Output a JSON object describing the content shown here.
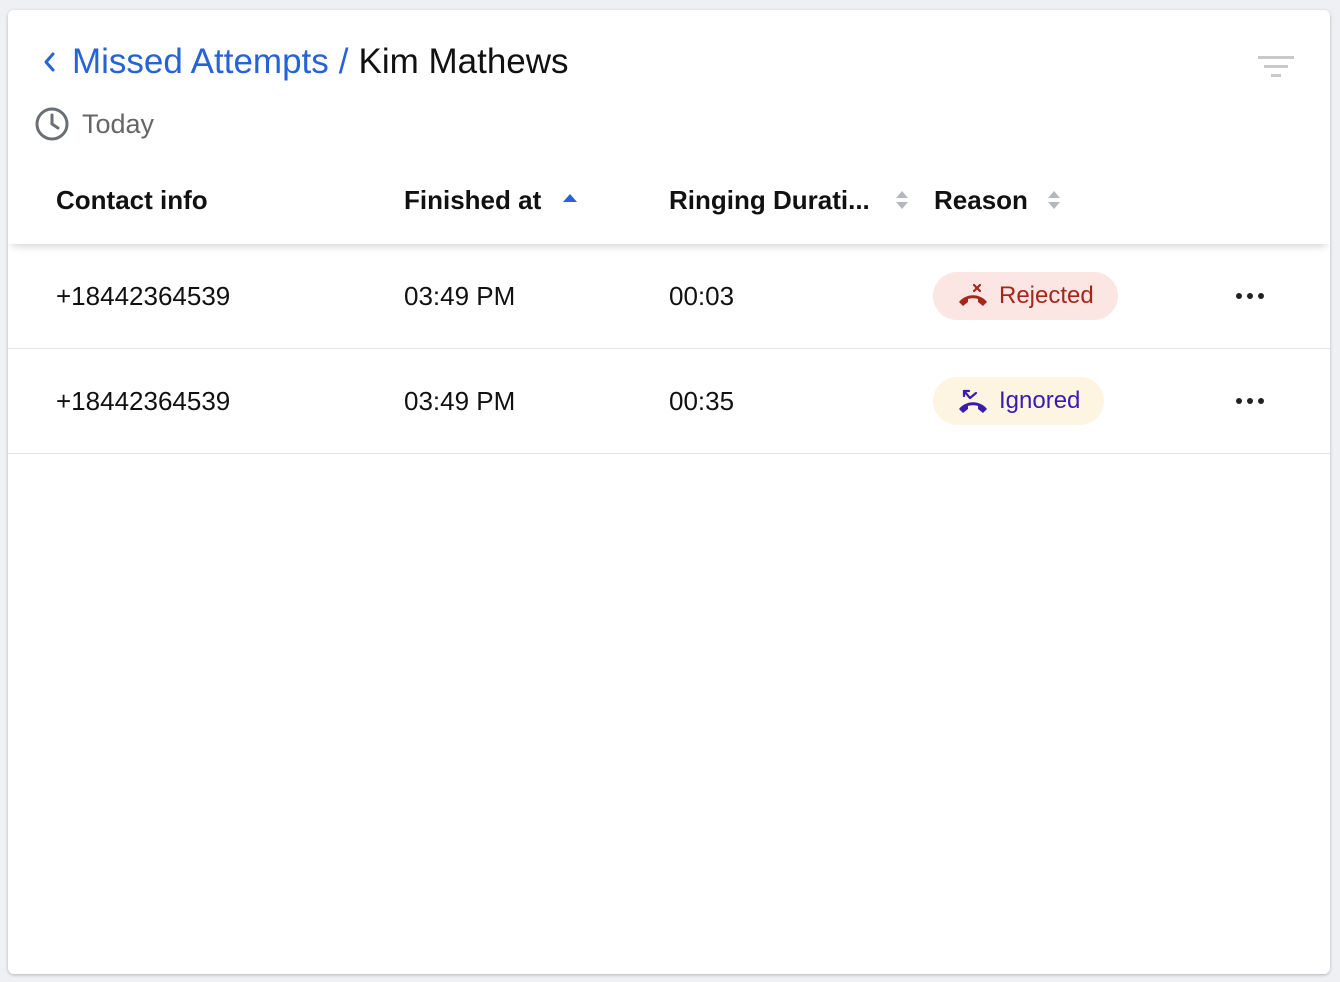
{
  "breadcrumb": {
    "parent": "Missed Attempts",
    "separator": "/",
    "current": "Kim Mathews"
  },
  "date_filter": {
    "label": "Today",
    "icon": "clock-icon"
  },
  "columns": [
    {
      "label": "Contact info",
      "sortable": false
    },
    {
      "label": "Finished at",
      "sort": "ascending"
    },
    {
      "label": "Ringing Durati...",
      "sort": "none"
    },
    {
      "label": "Reason",
      "sort": "none"
    }
  ],
  "rows": [
    {
      "contact": "+18442364539",
      "finished_at": "03:49 PM",
      "ringing_duration": "00:03",
      "reason": "Rejected",
      "reason_icon": "call-rejected-icon"
    },
    {
      "contact": "+18442364539",
      "finished_at": "03:49 PM",
      "ringing_duration": "00:35",
      "reason": "Ignored",
      "reason_icon": "call-ignored-icon"
    }
  ],
  "colors": {
    "link": "#2563d6",
    "rejected_bg": "#fbe6e4",
    "rejected_text": "#a8251b",
    "ignored_bg": "#fdf5e2",
    "ignored_text": "#3a1bb0"
  }
}
